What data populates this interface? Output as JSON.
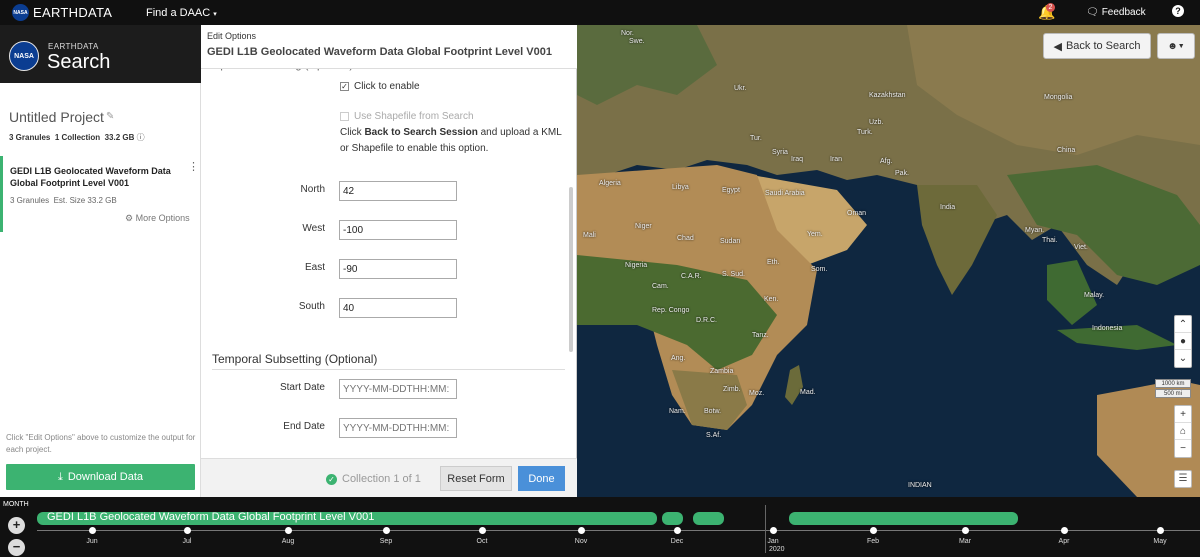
{
  "topbar": {
    "brand": "EARTHDATA",
    "nasa_logo": "NASA",
    "find_daac": "Find a DAAC",
    "find_daac_caret": "▾",
    "notification_count": "2",
    "bell_icon": "bell-icon",
    "feedback": "Feedback",
    "help": "?"
  },
  "left": {
    "header_small": "EARTHDATA",
    "header_big": "Search",
    "project_title": "Untitled Project",
    "granules": "3 Granules",
    "collections": "1 Collection",
    "size": "33.2 GB",
    "card": {
      "title": "GEDI L1B Geolocated Waveform Data Global Footprint Level V001",
      "granules": "3 Granules",
      "est_size": "Est. Size 33.2 GB",
      "more_options": "More Options"
    },
    "note": "Click \"Edit Options\" above to customize the output for each project.",
    "download": "Download Data"
  },
  "edit": {
    "label": "Edit Options",
    "title": "GEDI L1B Geolocated Waveform Data Global Footprint Level V001",
    "spatial_heading": "Spatial Subsetting (Optional)",
    "click_enable": "Click to enable",
    "use_shapefile": "Use Shapefile from Search",
    "hint_pre": "Click ",
    "hint_bold": "Back to Search Session",
    "hint_post": " and upload a KML or Shapefile to enable this option.",
    "fields": {
      "north": {
        "label": "North",
        "value": "42"
      },
      "west": {
        "label": "West",
        "value": "-100"
      },
      "east": {
        "label": "East",
        "value": "-90"
      },
      "south": {
        "label": "South",
        "value": "40"
      }
    },
    "temporal_heading": "Temporal Subsetting (Optional)",
    "start_label": "Start Date",
    "start_placeholder": "YYYY-MM-DDTHH:MM:",
    "end_label": "End Date",
    "end_placeholder": "YYYY-MM-DDTHH:MM:",
    "collection_status": "Collection 1 of 1",
    "reset": "Reset Form",
    "done": "Done"
  },
  "map": {
    "back_to_search": "Back to Search",
    "scale_km": "1000 km",
    "scale_mi": "500 mi",
    "labels": {
      "nor": "Nor.",
      "swe": "Swe.",
      "ukr": "Ukr.",
      "kazakhstan": "Kazakhstan",
      "mongolia": "Mongolia",
      "uzb": "Uzb.",
      "turk": "Turk.",
      "tur": "Tur.",
      "china": "China",
      "syria": "Syria",
      "iraq": "Iraq",
      "iran": "Iran",
      "afg": "Afg.",
      "pak": "Pak.",
      "libya": "Libya",
      "algeria": "Algeria",
      "egypt": "Egypt",
      "saudi": "Saudi Arabia",
      "oman": "Oman",
      "india": "India",
      "mali": "Mali",
      "niger": "Niger",
      "chad": "Chad",
      "sudan": "Sudan",
      "yem": "Yem.",
      "myan": "Myan.",
      "thai": "Thai.",
      "viet": "Viet.",
      "nigeria": "Nigeria",
      "car": "C.A.R.",
      "ssud": "S. Sud.",
      "eth": "Eth.",
      "som": "Som.",
      "cam": "Cam.",
      "ken": "Ken.",
      "repcongo": "Rep. Congo",
      "drc": "D.R.C.",
      "tanz": "Tanz.",
      "malay": "Malay.",
      "indonesia": "Indonesia",
      "ang": "Ang.",
      "zambia": "Zambia",
      "zimb": "Zimb.",
      "moz": "Moz.",
      "mad": "Mad.",
      "nam": "Nam.",
      "botw": "Botw.",
      "saf": "S.Af.",
      "indian": "INDIAN"
    }
  },
  "timeline": {
    "month": "MONTH",
    "zoom_in": "+",
    "zoom_out": "−",
    "bar_label": "GEDI L1B Geolocated Waveform Data Global Footprint Level V001",
    "months": [
      "Jun",
      "Jul",
      "Aug",
      "Sep",
      "Oct",
      "Nov",
      "Dec",
      "Jan",
      "Feb",
      "Mar",
      "Apr",
      "May"
    ],
    "year": "2020"
  }
}
